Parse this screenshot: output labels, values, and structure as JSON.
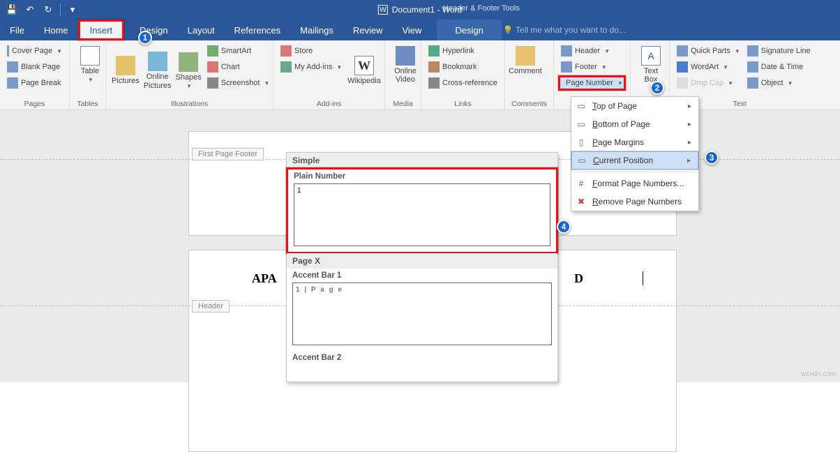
{
  "titlebar": {
    "document": "Document1 - Word",
    "context_group": "Header & Footer Tools"
  },
  "menubar": {
    "file": "File",
    "home": "Home",
    "insert": "Insert",
    "design": "Design",
    "layout": "Layout",
    "references": "References",
    "mailings": "Mailings",
    "review": "Review",
    "view": "View",
    "ctx_design": "Design",
    "tell": "Tell me what you want to do..."
  },
  "ribbon": {
    "pages": {
      "label": "Pages",
      "cover": "Cover Page",
      "blank": "Blank Page",
      "break": "Page Break"
    },
    "tables": {
      "label": "Tables",
      "table": "Table"
    },
    "illus": {
      "label": "Illustrations",
      "pictures": "Pictures",
      "online_pictures": "Online Pictures",
      "shapes": "Shapes",
      "smartart": "SmartArt",
      "chart": "Chart",
      "screenshot": "Screenshot"
    },
    "addins": {
      "label": "Add-ins",
      "store": "Store",
      "myaddins": "My Add-ins",
      "wikipedia": "Wikipedia"
    },
    "media": {
      "label": "Media",
      "online_video": "Online Video"
    },
    "links": {
      "label": "Links",
      "hyperlink": "Hyperlink",
      "bookmark": "Bookmark",
      "crossref": "Cross-reference"
    },
    "comments": {
      "label": "Comments",
      "comment": "Comment"
    },
    "hf": {
      "header": "Header",
      "footer": "Footer",
      "pagenum": "Page Number"
    },
    "text": {
      "label": "Text",
      "textbox": "Text Box",
      "quickparts": "Quick Parts",
      "wordart": "WordArt",
      "dropcap": "Drop Cap",
      "sigline": "Signature Line",
      "datetime": "Date & Time",
      "object": "Object"
    }
  },
  "pagenum_menu": {
    "top": "Top of Page",
    "bottom": "Bottom of Page",
    "margins": "Page Margins",
    "current": "Current Position",
    "format": "Format Page Numbers...",
    "remove": "Remove Page Numbers"
  },
  "gallery": {
    "simple": "Simple",
    "plain": "Plain Number",
    "n1": "1",
    "pagex": "Page X",
    "accent1": "Accent Bar 1",
    "accent1_sample": "1 | P a g e",
    "accent2": "Accent Bar 2"
  },
  "doc": {
    "first_footer": "First Page Footer",
    "header": "Header",
    "apa": "APA",
    "d": "D"
  },
  "watermark": "wsxdn.com"
}
